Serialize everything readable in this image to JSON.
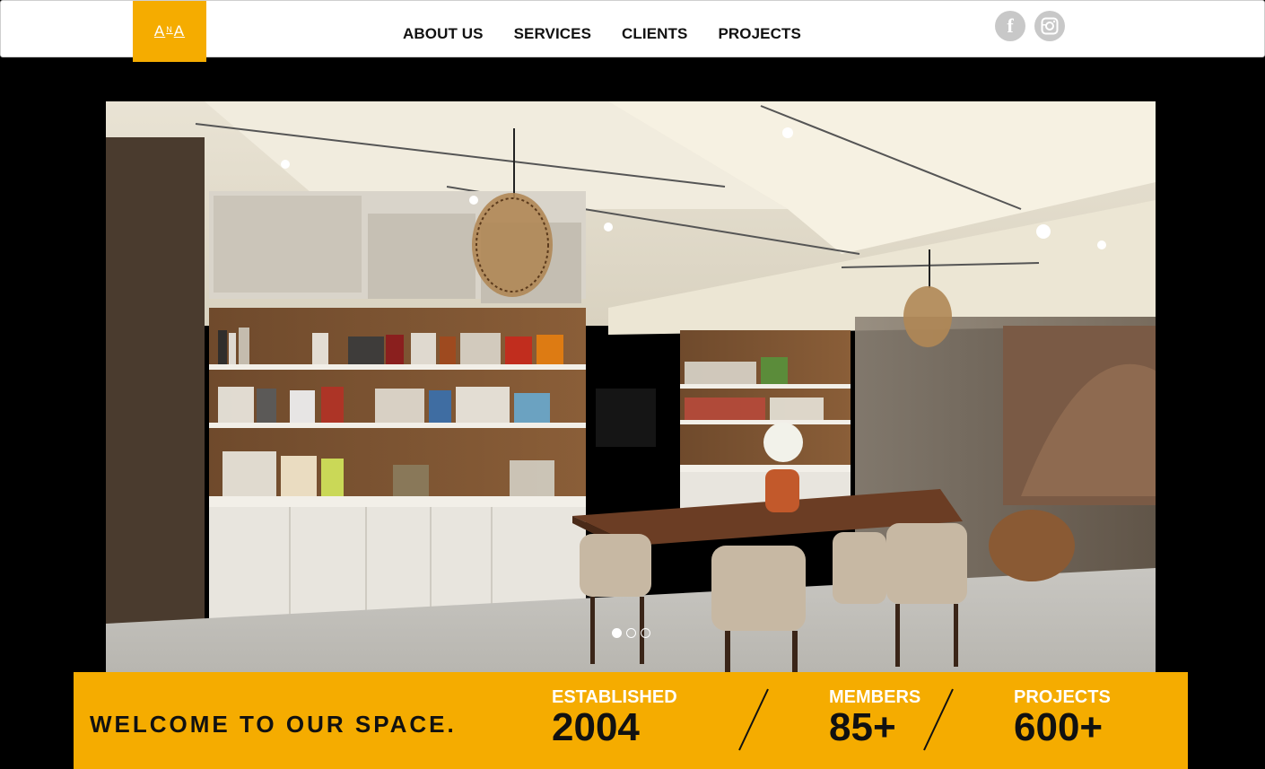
{
  "header": {
    "logo_left": "A",
    "logo_mid": "N",
    "logo_right": "A",
    "nav": [
      {
        "label": "ABOUT US"
      },
      {
        "label": "SERVICES"
      },
      {
        "label": "CLIENTS"
      },
      {
        "label": "PROJECTS"
      }
    ],
    "social": {
      "facebook_glyph": "f",
      "instagram_icon": "instagram-icon"
    }
  },
  "hero": {
    "slides": 3,
    "active_slide": 1
  },
  "band": {
    "welcome": "WELCOME TO OUR SPACE.",
    "stats": [
      {
        "label": "ESTABLISHED",
        "value": "2004"
      },
      {
        "label": "MEMBERS",
        "value": "85+"
      },
      {
        "label": "PROJECTS",
        "value": "600+"
      }
    ]
  },
  "colors": {
    "accent": "#f5ac00",
    "background": "#000000",
    "icon_grey": "#c8c8c8"
  }
}
